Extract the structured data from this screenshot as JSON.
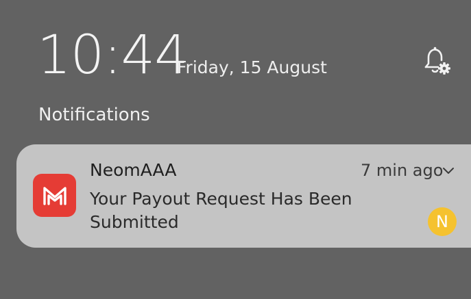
{
  "status": {
    "time": "10:44",
    "date": "Friday, 15 August"
  },
  "section": {
    "title": "Notifications"
  },
  "notification": {
    "app_name": "NeomAAA",
    "time_ago": "7 min ago",
    "message": "Your Payout Request Has Been Submitted",
    "avatar_letter": "N",
    "app_icon": "gmail-style-m-icon",
    "colors": {
      "app_icon_bg": "#e53c35",
      "avatar_bg": "#f5c22f",
      "card_bg": "#c4c4c4",
      "screen_bg": "#626262"
    }
  }
}
